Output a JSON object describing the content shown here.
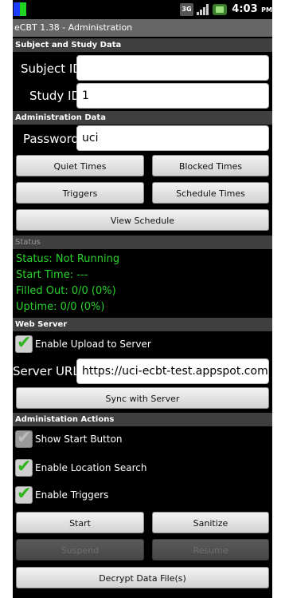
{
  "status_bar": {
    "time": "4:03",
    "ampm": "PM",
    "network": "3G"
  },
  "title": "eCBT 1.38 - Administration",
  "subject_section": {
    "header": "Subject and Study Data",
    "subject_id_label": "Subject ID:",
    "subject_id_value": "",
    "study_id_label": "Study ID:",
    "study_id_value": "1"
  },
  "admin_section": {
    "header": "Administration Data",
    "password_label": "Password:",
    "password_value": "uci",
    "buttons": {
      "quiet_times": "Quiet Times",
      "blocked_times": "Blocked Times",
      "triggers": "Triggers",
      "schedule_times": "Schedule Times",
      "view_schedule": "View Schedule"
    }
  },
  "status_section": {
    "header": "Status",
    "status": "Status:  Not Running",
    "start_time": "Start Time:  ---",
    "filled_out": "Filled Out:  0/0 (0%)",
    "uptime": "Uptime:  0/0 (0%)"
  },
  "web_server": {
    "header": "Web Server",
    "enable_upload_label": "Enable Upload to Server",
    "enable_upload_checked": true,
    "server_url_label": "Server URL:",
    "server_url_value": "https://uci-ecbt-test.appspot.com/",
    "sync_button": "Sync with Server"
  },
  "actions": {
    "header": "Administation Actions",
    "show_start_label": "Show Start Button",
    "show_start_checked": true,
    "location_search_label": "Enable Location Search",
    "location_search_checked": true,
    "triggers_label": "Enable Triggers",
    "triggers_checked": true,
    "start": "Start",
    "sanitize": "Sanitize",
    "suspend": "Suspend",
    "resume": "Resume",
    "decrypt": "Decrypt Data File(s)"
  },
  "colors": {
    "status_green": "#29d32d",
    "checkmark_green": "#2fb51d",
    "section_bg": "#3f3f3f",
    "title_bg": "#666666"
  }
}
